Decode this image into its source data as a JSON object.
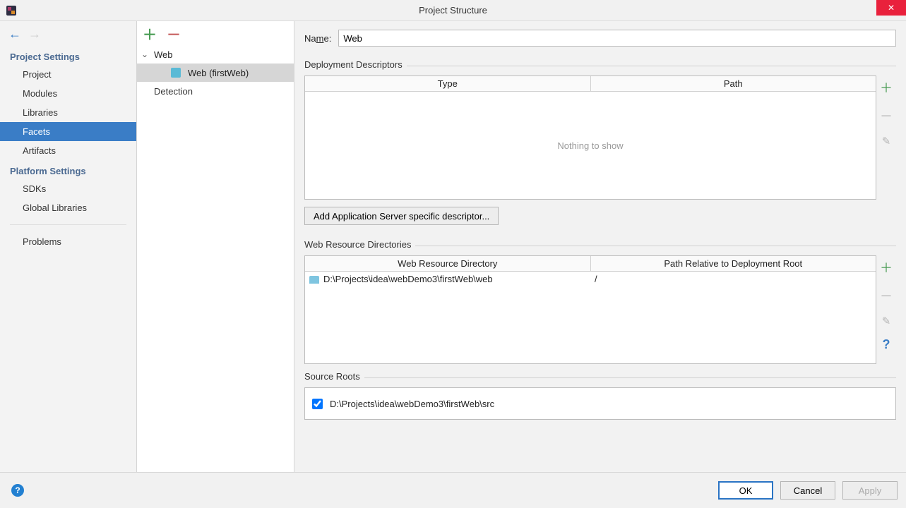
{
  "window": {
    "title": "Project Structure"
  },
  "sidebar": {
    "sections": {
      "project_settings": "Project Settings",
      "platform_settings": "Platform Settings"
    },
    "items": {
      "project": "Project",
      "modules": "Modules",
      "libraries": "Libraries",
      "facets": "Facets",
      "artifacts": "Artifacts",
      "sdks": "SDKs",
      "global_libs": "Global Libraries",
      "problems": "Problems"
    }
  },
  "facets_tree": {
    "root": "Web",
    "child": "Web (firstWeb)",
    "detection": "Detection"
  },
  "form": {
    "name_label_pre": "Na",
    "name_label_u": "m",
    "name_label_post": "e:",
    "name_value": "Web"
  },
  "deploy": {
    "group": "Deployment Descriptors",
    "col_type": "Type",
    "col_path": "Path",
    "empty": "Nothing to show",
    "add_btn": "Add Application Server specific descriptor..."
  },
  "webres": {
    "group": "Web Resource Directories",
    "col_dir": "Web Resource Directory",
    "col_path": "Path Relative to Deployment Root",
    "row": {
      "dir": "D:\\Projects\\idea\\webDemo3\\firstWeb\\web",
      "path": "/"
    }
  },
  "source_roots": {
    "group": "Source Roots",
    "item": "D:\\Projects\\idea\\webDemo3\\firstWeb\\src"
  },
  "footer": {
    "ok": "OK",
    "cancel": "Cancel",
    "apply": "Apply"
  }
}
